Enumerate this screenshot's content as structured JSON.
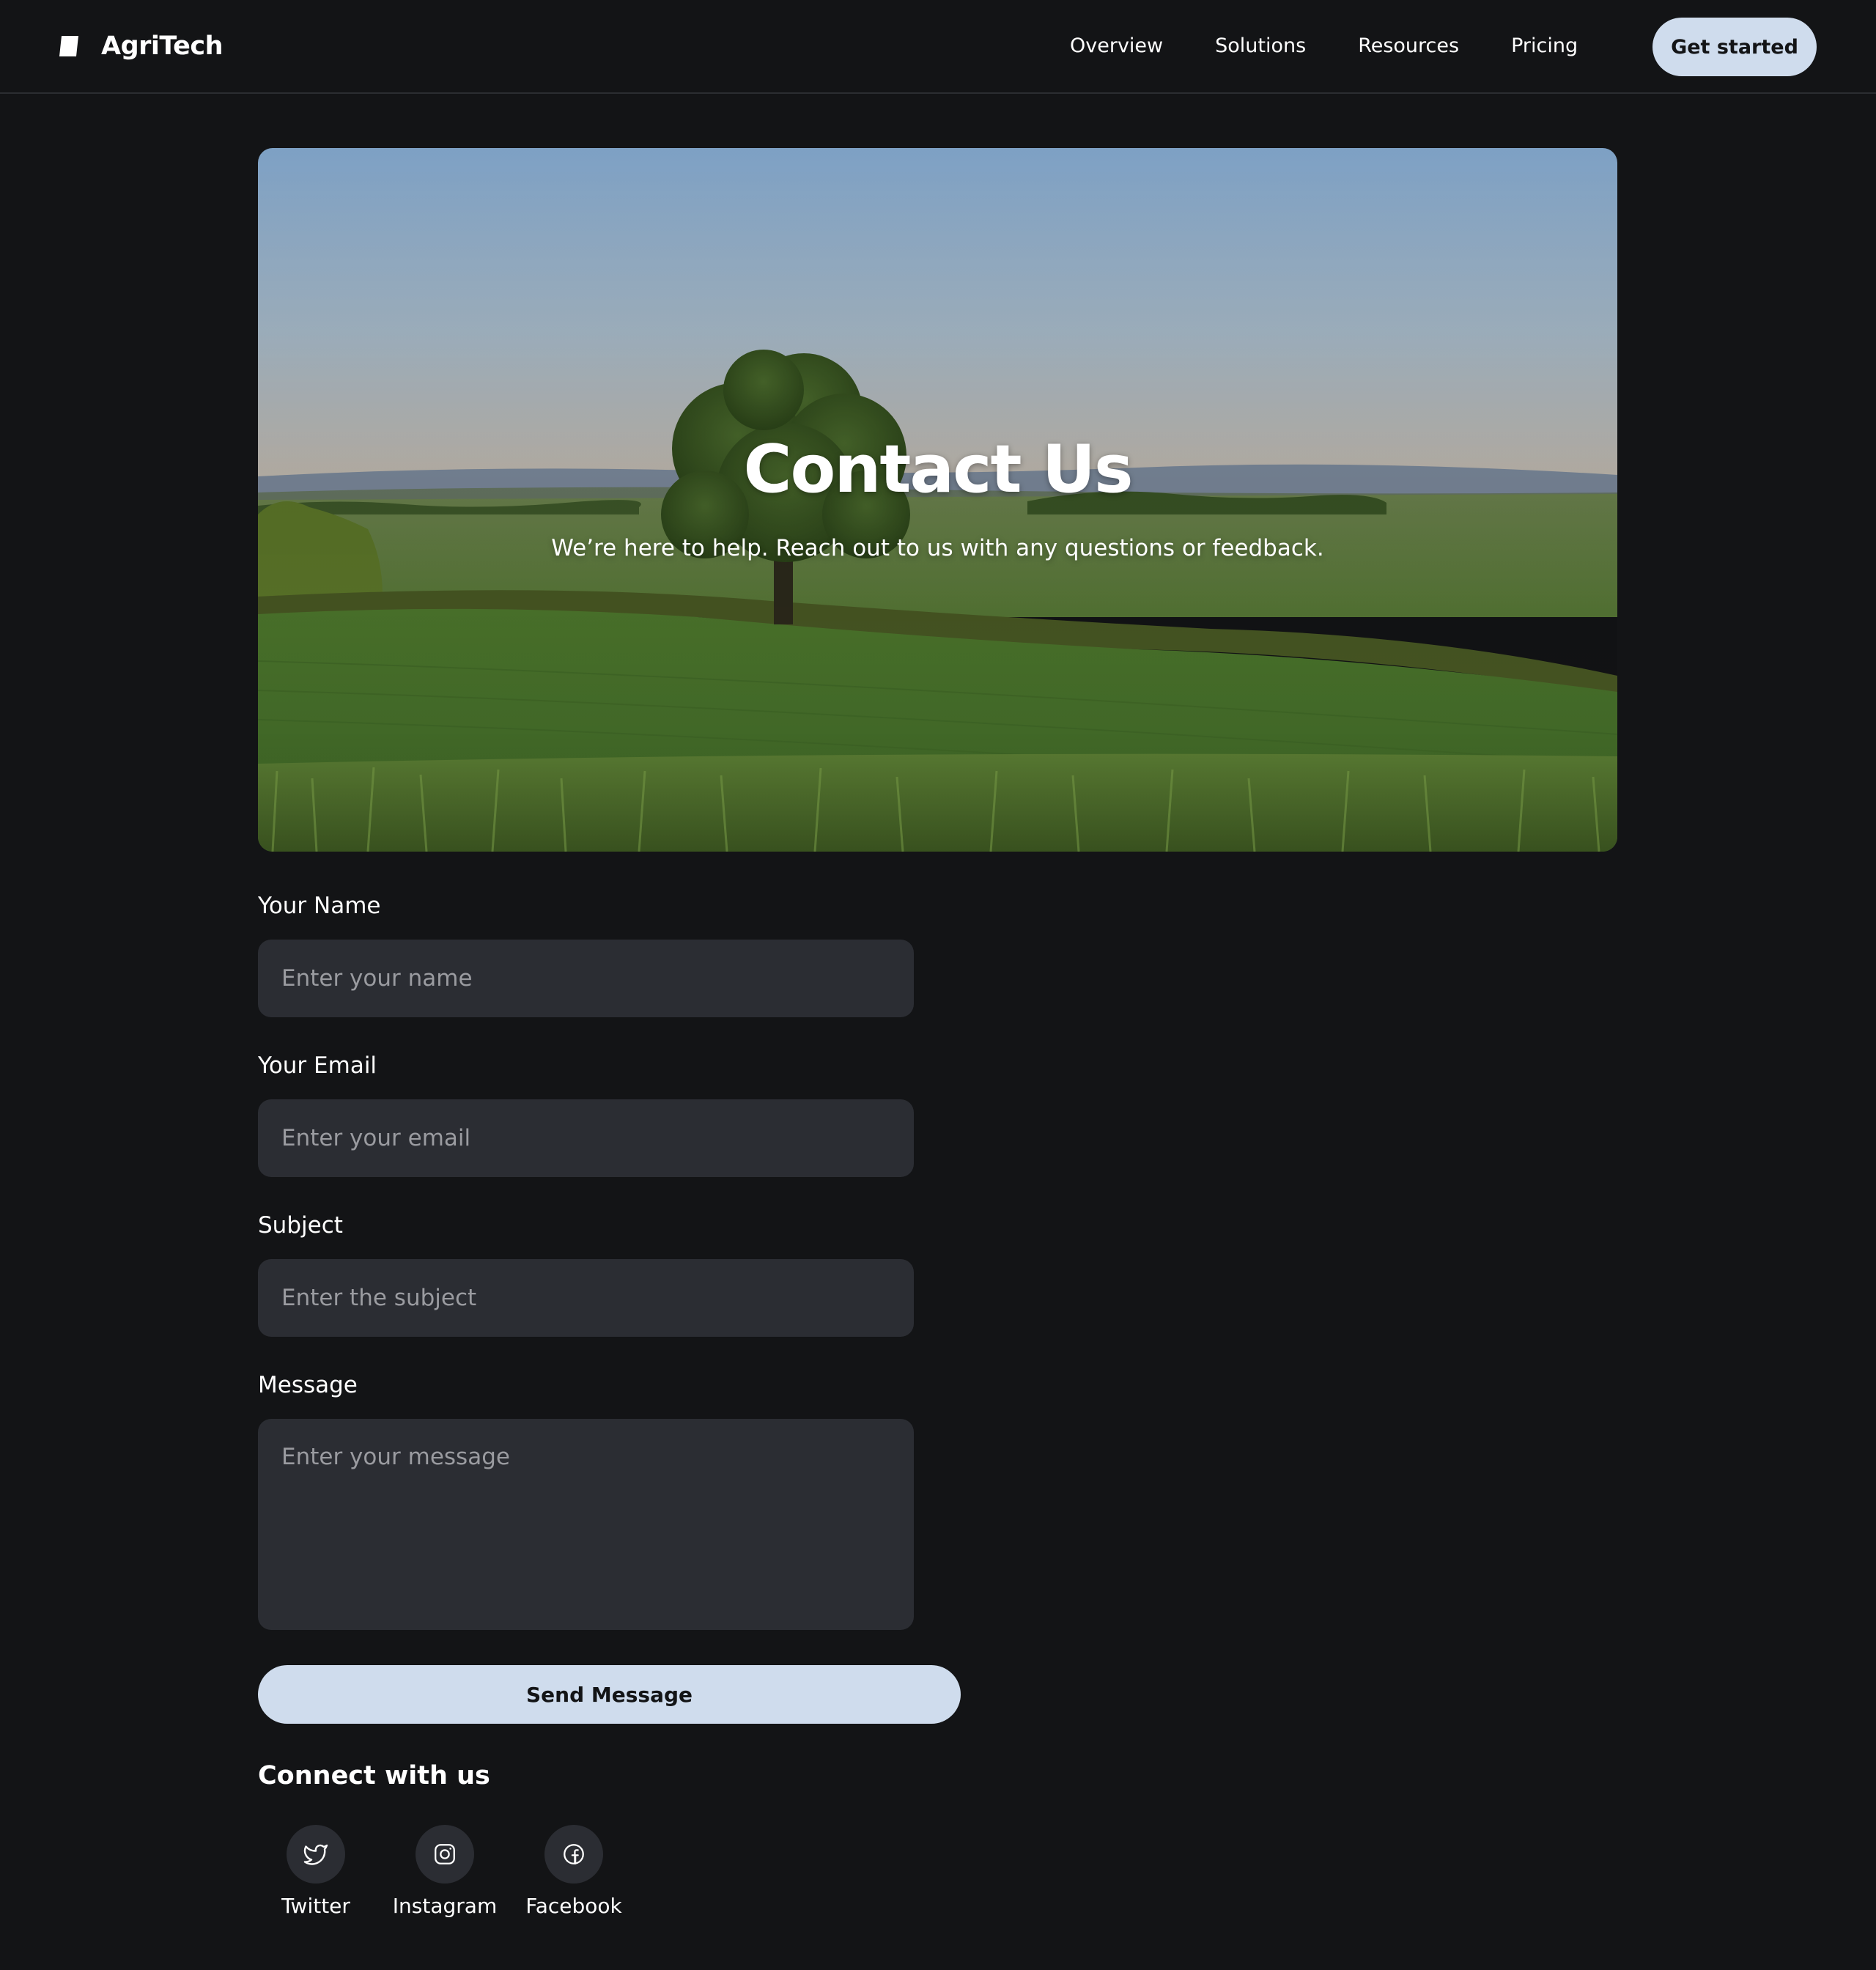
{
  "brand": {
    "name": "AgriTech",
    "logo_icon": "brand-mark-icon"
  },
  "nav": {
    "links": [
      "Overview",
      "Solutions",
      "Resources",
      "Pricing"
    ],
    "cta": "Get started"
  },
  "hero": {
    "title": "Contact Us",
    "subtitle": "We’re here to help. Reach out to us with any questions or feedback.",
    "image": "farm-landscape-photo"
  },
  "form": {
    "name": {
      "label": "Your Name",
      "placeholder": "Enter your name",
      "value": ""
    },
    "email": {
      "label": "Your Email",
      "placeholder": "Enter your email",
      "value": ""
    },
    "subject": {
      "label": "Subject",
      "placeholder": "Enter the subject",
      "value": ""
    },
    "message": {
      "label": "Message",
      "placeholder": "Enter your message",
      "value": ""
    },
    "submit": "Send Message"
  },
  "connect": {
    "title": "Connect with us",
    "links": [
      {
        "label": "Twitter",
        "icon": "twitter-icon"
      },
      {
        "label": "Instagram",
        "icon": "instagram-icon"
      },
      {
        "label": "Facebook",
        "icon": "facebook-icon"
      }
    ]
  },
  "colors": {
    "background": "#131416",
    "surface": "#2b2d33",
    "accent": "#cfdced",
    "text": "#ffffff",
    "placeholder": "#9a9ba0"
  }
}
